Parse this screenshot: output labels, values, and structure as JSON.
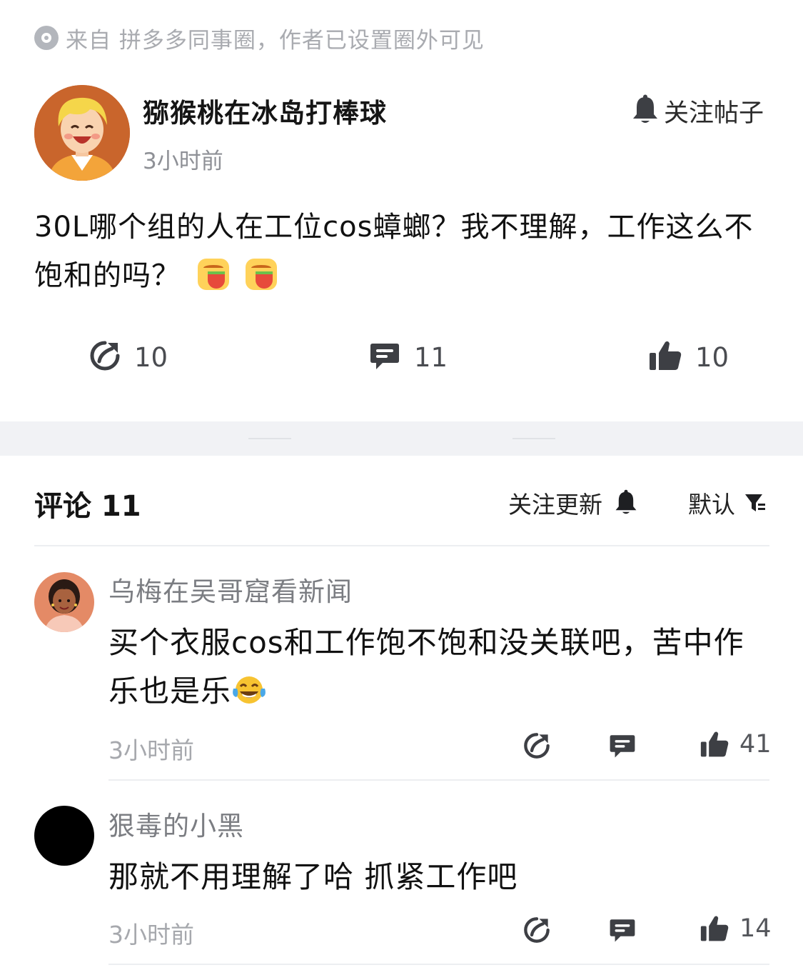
{
  "source": {
    "text": "来自 拼多多同事圈，作者已设置圈外可见",
    "icon": "circle-dot-icon"
  },
  "post": {
    "author": "猕猴桃在冰岛打棒球",
    "time": "3小时前",
    "follow_label": "关注帖子",
    "text": "30L哪个组的人在工位cos蟑螂？我不理解，工作这么不饱和的吗？",
    "emoji": "watermelon-face-emoji",
    "share_count": "10",
    "comment_count": "11",
    "like_count": "10"
  },
  "comments_header": {
    "title": "评论 11",
    "follow_update_label": "关注更新",
    "sort_label": "默认"
  },
  "comments": [
    {
      "author": "乌梅在吴哥窟看新闻",
      "text": "买个衣服cos和工作饱不饱和没关联吧，苦中作乐也是乐",
      "emoji": "tears-of-joy-emoji",
      "time": "3小时前",
      "like_count": "41"
    },
    {
      "author": "狠毒的小黑",
      "text": "那就不用理解了哈 抓紧工作吧",
      "time": "3小时前",
      "like_count": "14"
    }
  ],
  "colors": {
    "accent_icon": "#3d3f44",
    "muted_text": "#a9abb0",
    "divider": "#f1f2f5"
  }
}
